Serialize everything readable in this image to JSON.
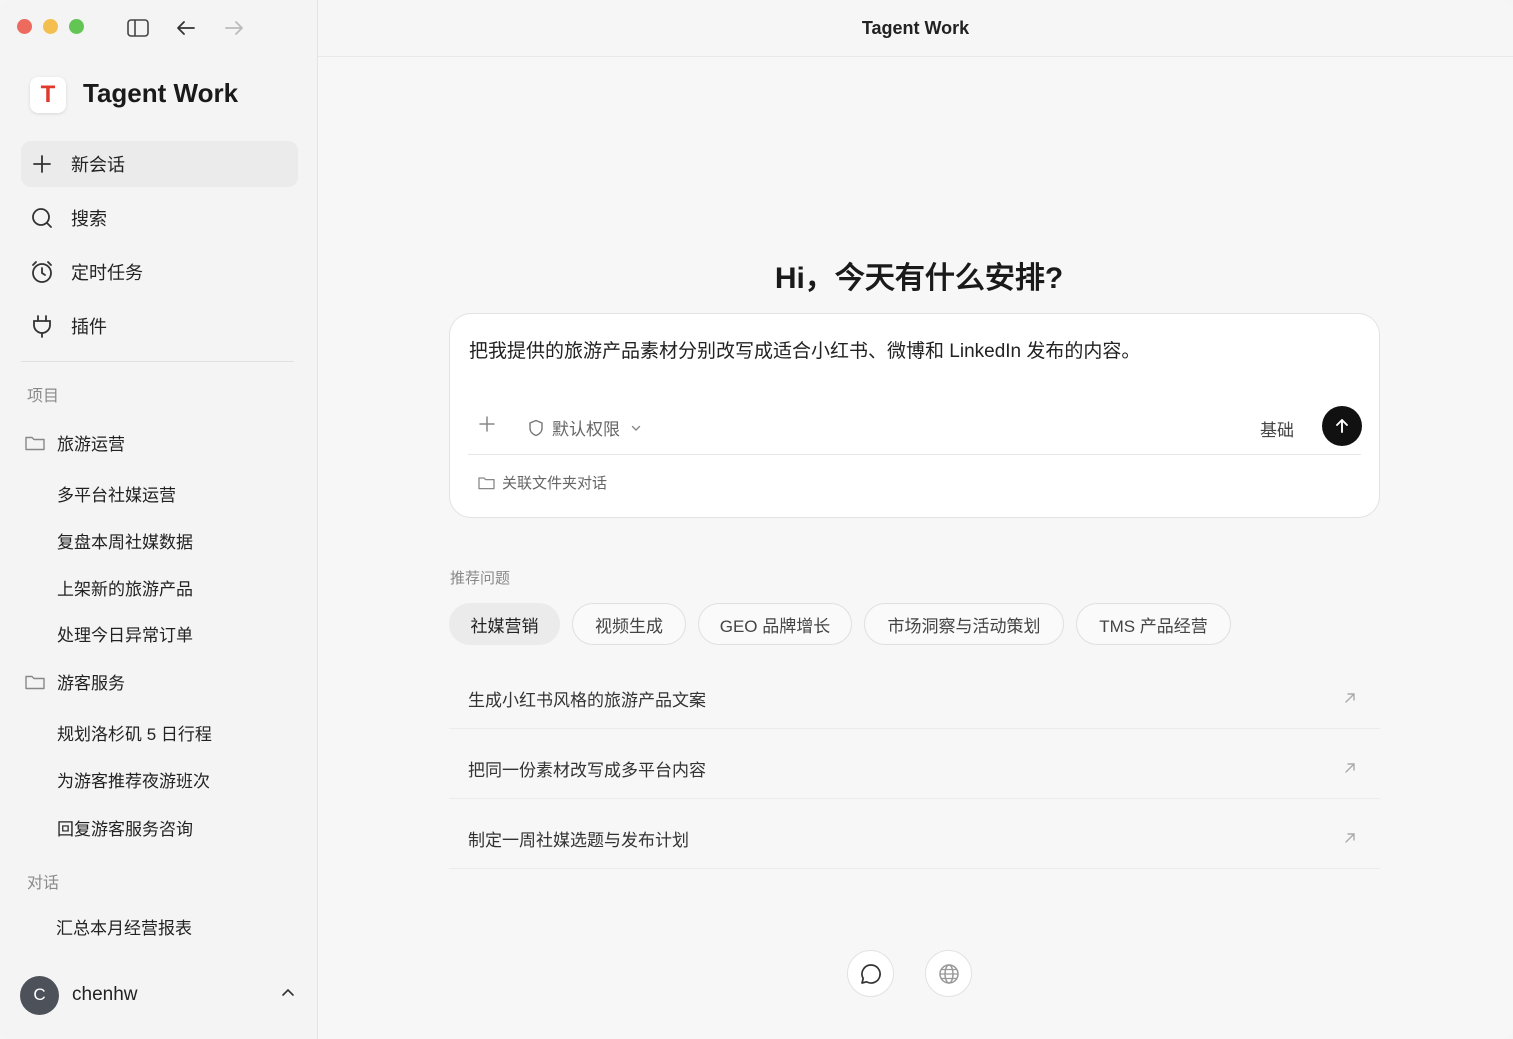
{
  "window": {
    "title": "Tagent Work"
  },
  "sidebar": {
    "brand": "Tagent Work",
    "logo_letter": "T",
    "nav": [
      {
        "label": "新会话",
        "icon": "plus-icon"
      },
      {
        "label": "搜索",
        "icon": "search-icon"
      },
      {
        "label": "定时任务",
        "icon": "alarm-clock-icon"
      },
      {
        "label": "插件",
        "icon": "plug-icon"
      }
    ],
    "projects_label": "项目",
    "projects": [
      {
        "name": "旅游运营",
        "items": [
          "多平台社媒运营",
          "复盘本周社媒数据",
          "上架新的旅游产品",
          "处理今日异常订单"
        ]
      },
      {
        "name": "游客服务",
        "items": [
          "规划洛杉矶 5 日行程",
          "为游客推荐夜游班次",
          "回复游客服务咨询"
        ]
      }
    ],
    "conversations_label": "对话",
    "conversations": [
      "汇总本月经营报表"
    ],
    "user": {
      "initial": "C",
      "name": "chenhw"
    }
  },
  "main": {
    "greeting": "Hi，今天有什么安排?",
    "composer": {
      "text": "把我提供的旅游产品素材分别改写成适合小红书、微博和 LinkedIn 发布的内容。",
      "permission": "默认权限",
      "mode": "基础",
      "link_folder": "关联文件夹对话"
    },
    "suggest_label": "推荐问题",
    "chips": [
      "社媒营销",
      "视频生成",
      "GEO 品牌增长",
      "市场洞察与活动策划",
      "TMS 产品经营"
    ],
    "suggestions": [
      "生成小红书风格的旅游产品文案",
      "把同一份素材改写成多平台内容",
      "制定一周社媒选题与发布计划"
    ]
  }
}
